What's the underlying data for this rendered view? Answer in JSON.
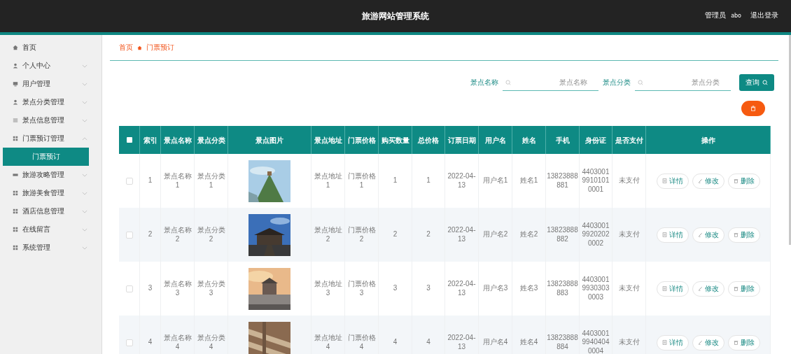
{
  "header": {
    "title": "旅游网站管理系统",
    "role": "管理员",
    "username": "abo",
    "logout": "退出登录"
  },
  "sidebar": {
    "items": [
      {
        "label": "首页"
      },
      {
        "label": "个人中心",
        "expanded": false
      },
      {
        "label": "用户管理",
        "expanded": false
      },
      {
        "label": "景点分类管理",
        "expanded": false
      },
      {
        "label": "景点信息管理",
        "expanded": false
      },
      {
        "label": "门票预订管理",
        "expanded": true,
        "children": [
          {
            "label": "门票预订",
            "selected": true
          }
        ]
      },
      {
        "label": "旅游攻略管理",
        "expanded": false
      },
      {
        "label": "旅游美食管理",
        "expanded": false
      },
      {
        "label": "酒店信息管理",
        "expanded": false
      },
      {
        "label": "在线留言",
        "expanded": false
      },
      {
        "label": "系统管理",
        "expanded": false
      }
    ]
  },
  "breadcrumb": [
    "首页",
    "门票预订"
  ],
  "search": {
    "fields": [
      {
        "label": "景点名称",
        "placeholder": "景点名称"
      },
      {
        "label": "景点分类",
        "placeholder": "景点分类"
      }
    ],
    "button": "查询"
  },
  "table": {
    "header_checkbox": {
      "checked": false
    },
    "columns": [
      "索引",
      "景点名称",
      "景点分类",
      "景点图片",
      "景点地址",
      "门票价格",
      "购买数量",
      "总价格",
      "订票日期",
      "用户名",
      "姓名",
      "手机",
      "身份证",
      "是否支付",
      "操作"
    ],
    "rows": [
      {
        "checked": false,
        "cells": [
          "1",
          "景点名称1",
          "景点分类1",
          {
            "kind": "picture"
          },
          "景点地址1",
          "门票价格1",
          "1",
          "1",
          "2022-04-13",
          "用户名1",
          "姓名1",
          "13823888881",
          "440300199101010001",
          "未支付"
        ],
        "actions": [
          "详情",
          "修改",
          "删除"
        ]
      },
      {
        "checked": false,
        "cells": [
          "2",
          "景点名称2",
          "景点分类2",
          {
            "kind": "picture"
          },
          "景点地址2",
          "门票价格2",
          "2",
          "2",
          "2022-04-13",
          "用户名2",
          "姓名2",
          "13823888882",
          "440300199202020002",
          "未支付"
        ],
        "actions": [
          "详情",
          "修改",
          "删除"
        ]
      },
      {
        "checked": false,
        "cells": [
          "3",
          "景点名称3",
          "景点分类3",
          {
            "kind": "picture"
          },
          "景点地址3",
          "门票价格3",
          "3",
          "3",
          "2022-04-13",
          "用户名3",
          "姓名3",
          "13823888883",
          "440300199303030003",
          "未支付"
        ],
        "actions": [
          "详情",
          "修改",
          "删除"
        ]
      },
      {
        "checked": false,
        "cells": [
          "4",
          "景点名称4",
          "景点分类4",
          {
            "kind": "picture"
          },
          "景点地址4",
          "门票价格4",
          "4",
          "4",
          "2022-04-13",
          "用户名4",
          "姓名4",
          "13823888884",
          "440300199404040004",
          "未支付"
        ],
        "actions": [
          "详情",
          "修改",
          "删除"
        ]
      }
    ]
  }
}
